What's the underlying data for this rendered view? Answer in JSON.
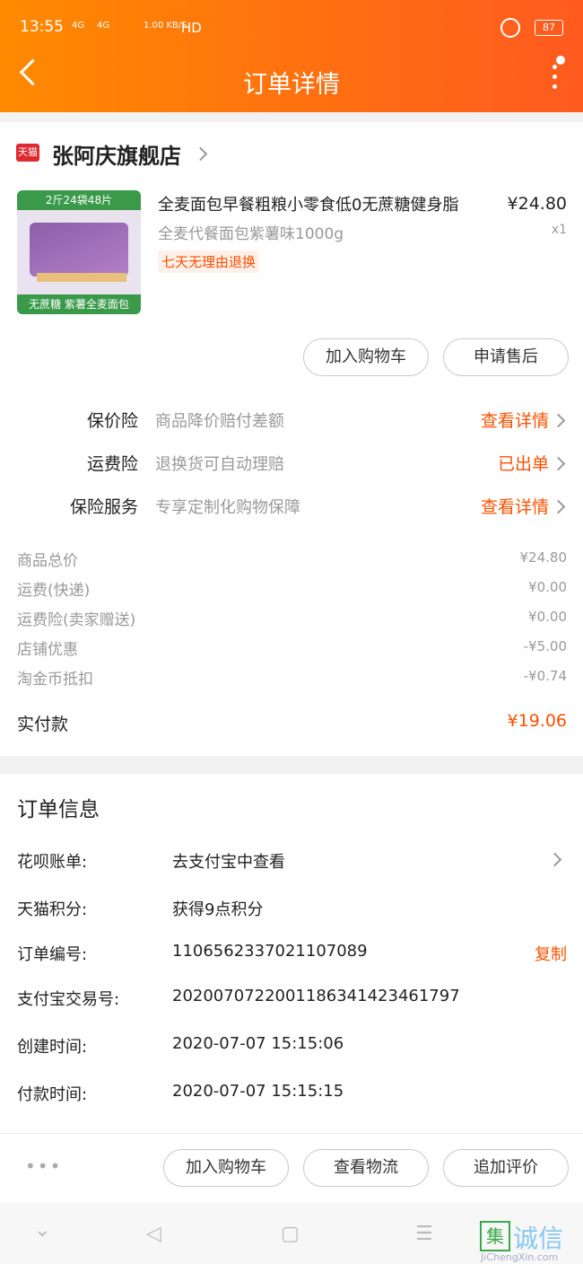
{
  "status_bar": {
    "time": "13:55",
    "signal1": "4G",
    "signal2": "4G",
    "speed": "1.00 KB/S",
    "hd": "HD",
    "battery": "87"
  },
  "header": {
    "title": "订单详情"
  },
  "shop": {
    "logo_text": "天猫",
    "name": "张阿庆旗舰店"
  },
  "product": {
    "image_top_text": "2斤24袋48片",
    "image_bottom_text": "无蔗糖 紫薯全麦面包",
    "title": "全麦面包早餐粗粮小零食低0无蔗糖健身脂",
    "subtitle": "全麦代餐面包紫薯味1000g",
    "tag": "七天无理由退换",
    "price": "¥24.80",
    "qty": "x1"
  },
  "item_buttons": {
    "add_cart": "加入购物车",
    "after_sale": "申请售后"
  },
  "insurance": [
    {
      "label": "保价险",
      "desc": "商品降价赔付差额",
      "link": "查看详情"
    },
    {
      "label": "运费险",
      "desc": "退换货可自动理赔",
      "link": "已出单"
    },
    {
      "label": "保险服务",
      "desc": "专享定制化购物保障",
      "link": "查看详情"
    }
  ],
  "fees": [
    {
      "label": "商品总价",
      "value": "¥24.80"
    },
    {
      "label": "运费(快递)",
      "value": "¥0.00"
    },
    {
      "label": "运费险(卖家赠送)",
      "value": "¥0.00"
    },
    {
      "label": "店铺优惠",
      "value": "-¥5.00"
    },
    {
      "label": "淘金币抵扣",
      "value": "-¥0.74"
    }
  ],
  "paid": {
    "label": "实付款",
    "value": "¥19.06"
  },
  "order_info": {
    "title": "订单信息",
    "rows": [
      {
        "label": "花呗账单:",
        "value": "去支付宝中查看"
      },
      {
        "label": "天猫积分:",
        "value": "获得9点积分"
      },
      {
        "label": "订单编号:",
        "value": "1106562337021107089",
        "action": "复制"
      },
      {
        "label": "支付宝交易号:",
        "value": "2020070722001186341423461797"
      },
      {
        "label": "创建时间:",
        "value": "2020-07-07 15:15:06"
      },
      {
        "label": "付款时间:",
        "value": "2020-07-07 15:15:15"
      }
    ]
  },
  "bottom": {
    "more": "•••",
    "add_cart": "加入购物车",
    "logistics": "查看物流",
    "review": "追加评价"
  },
  "watermark": {
    "char1": "集",
    "chars": "诚信",
    "site": "JiChengXin.com"
  }
}
